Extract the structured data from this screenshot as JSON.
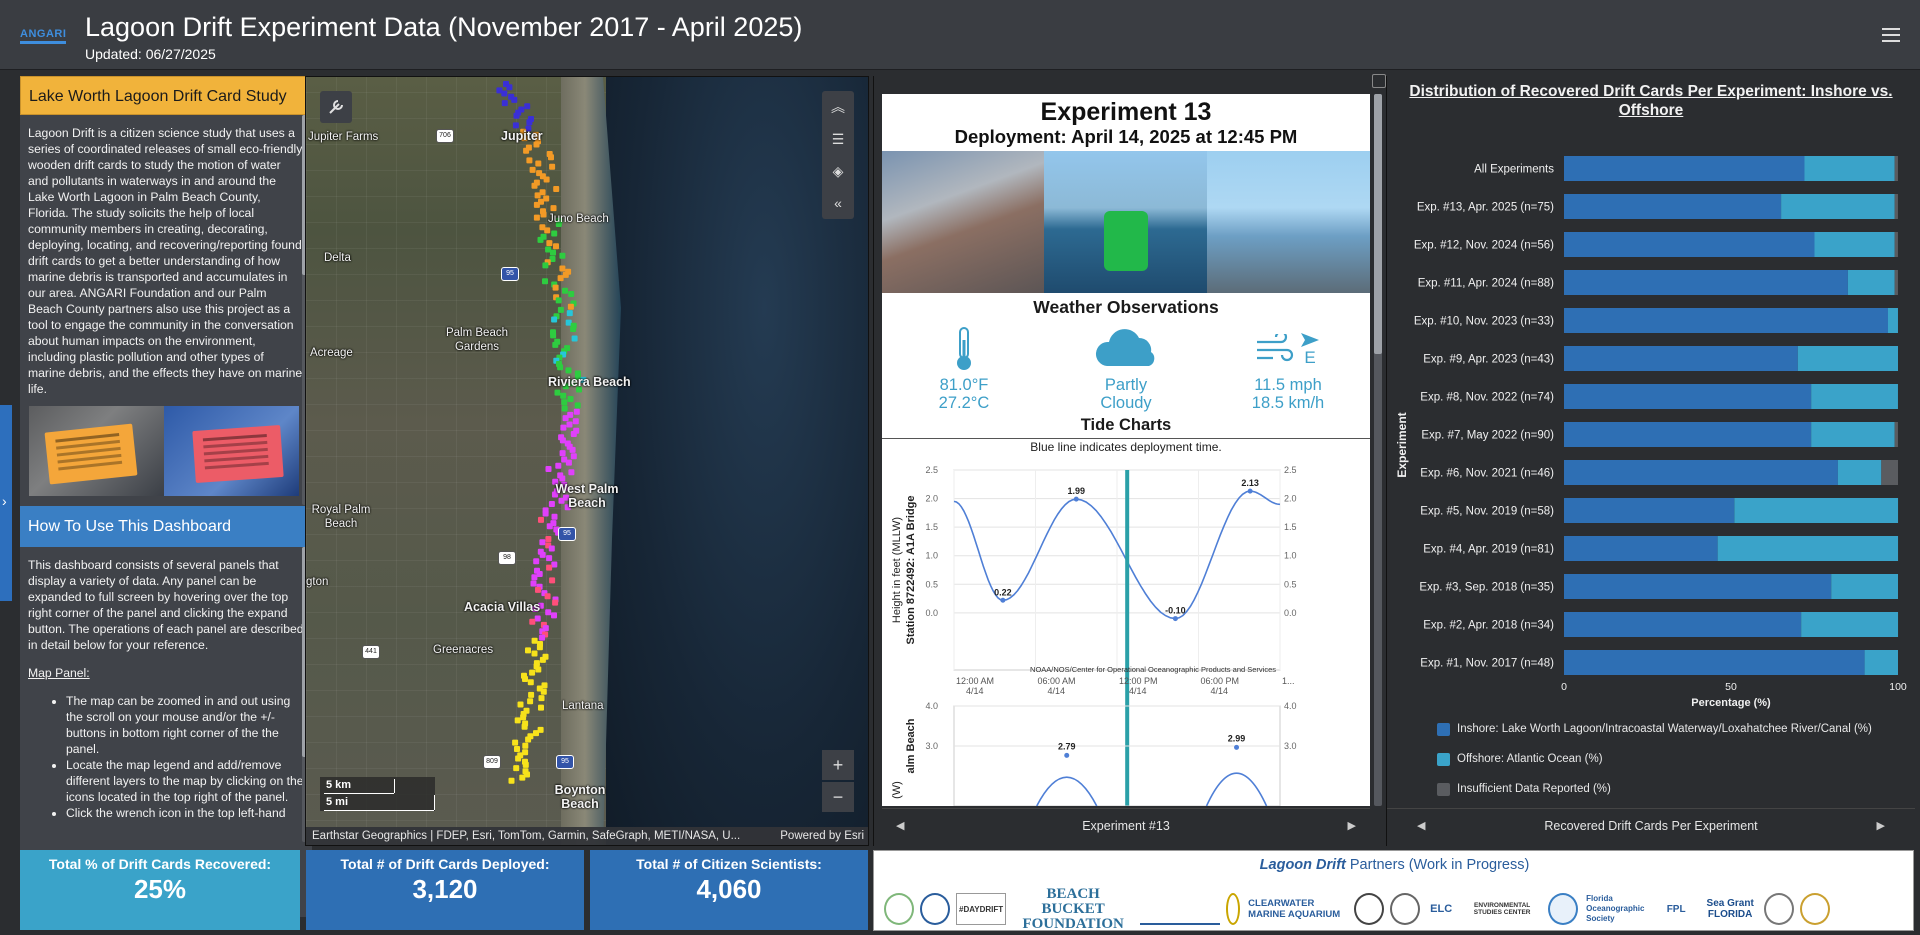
{
  "header": {
    "logo": "ANGARI",
    "title": "Lagoon Drift Experiment Data (November 2017 - April 2025)",
    "updated": "Updated: 06/27/2025"
  },
  "card_study": {
    "title": "Lake Worth Lagoon Drift Card Study",
    "body": "Lagoon Drift is a citizen science study that uses a series of coordinated releases of small eco-friendly wooden drift cards to study the motion of water and pollutants in waterways in and around the Lake Worth Lagoon in Palm Beach County, Florida. The study solicits the help of local community members in creating, decorating, deploying, locating, and recovering/reporting found drift cards to get a better understanding of how marine debris is transported and accumulates in our area. ANGARI Foundation and our Palm Beach County partners also use this project as a tool to engage the community in the conversation about human impacts on the environment, including plastic pollution and other types of marine debris, and the effects they have on marine life."
  },
  "howto": {
    "title": "How To Use This Dashboard",
    "intro": "This dashboard consists of several panels that display a variety of data. Any panel can be expanded to full screen by hovering over the top right corner of the panel and clicking the expand button. The operations of each panel are described in detail below for your reference.",
    "map_heading": "Map Panel:",
    "bullets": [
      "The map can be zoomed in and out using the scroll on your mouse and/or the +/- buttons in bottom right corner of the the panel.",
      "Locate the map legend and add/remove different layers to the map by clicking on the icons located in the top right of the panel.",
      "Click the wrench icon in the top left-hand"
    ]
  },
  "map": {
    "labels": {
      "jupiter_farms": "Jupiter Farms",
      "jupiter": "Jupiter",
      "juno_beach": "Juno Beach",
      "delta": "Delta",
      "palm_beach_gardens": "Palm Beach Gardens",
      "acreage": "Acreage",
      "riviera_beach": "Riviera Beach",
      "royal_palm_beach": "Royal Palm Beach",
      "west_palm_beach": "West Palm Beach",
      "wellington": "gton",
      "acacia_villas": "Acacia Villas",
      "greenacres": "Greenacres",
      "lantana": "Lantana",
      "boynton_beach": "Boynton Beach"
    },
    "shields": {
      "s706": "706",
      "s95a": "95",
      "s95b": "95",
      "s98": "98",
      "s441": "441",
      "s809": "809",
      "s95c": "95"
    },
    "scale_km": "5 km",
    "scale_mi": "5 mi",
    "attribution": "Earthstar Geographics | FDEP, Esri, TomTom, Garmin, SafeGraph, METI/NASA, U...",
    "powered": "Powered by Esri",
    "zoom_in": "+",
    "zoom_out": "−"
  },
  "experiment": {
    "title": "Experiment 13",
    "deployment": "Deployment: April 14, 2025 at 12:45 PM",
    "weather_title": "Weather Observations",
    "temp_f": "81.0°F",
    "temp_c": "27.2°C",
    "sky_1": "Partly",
    "sky_2": "Cloudy",
    "wind_dir": "E",
    "wind_mph": "11.5 mph",
    "wind_kmh": "18.5 km/h",
    "tide_title": "Tide Charts",
    "tide_note": "Blue line indicates deployment time.",
    "tide_ylabel_1": "Height in feet (MLLW)",
    "tide_ylabel_2": "Station 8722492: A1A Bridge",
    "tide_source": "NOAA/NOS/Center for Operational Oceanographic Products and Services",
    "tide2_ylabel_1": "(W)",
    "tide2_ylabel_2": "alm Beach",
    "nav_label": "Experiment #13",
    "tide_chart": {
      "type": "line",
      "x": [
        "12:00 AM 4/14",
        "06:00 AM 4/14",
        "12:00 PM 4/14",
        "06:00 PM 4/14",
        "1..."
      ],
      "annotations": [
        {
          "label": "0.22",
          "hour": 3.6,
          "value": 0.22
        },
        {
          "label": "1.99",
          "hour": 9.0,
          "value": 1.99
        },
        {
          "label": "-0.10",
          "hour": 16.3,
          "value": -0.1
        },
        {
          "label": "2.13",
          "hour": 21.8,
          "value": 2.13
        }
      ],
      "deployment_hour": 12.75,
      "ylim": [
        -0.3,
        2.5
      ],
      "yticks": [
        "2.5",
        "2.0",
        "1.5",
        "1.0",
        "0.5",
        "0.0"
      ],
      "xticks_top": [
        "12:00 AM",
        "06:00 AM",
        "12:00 PM",
        "06:00 PM",
        "1..."
      ],
      "xticks_bottom": [
        "4/14",
        "4/14",
        "4/14",
        "4/14",
        ""
      ]
    },
    "tide_chart_2": {
      "yticks": [
        "4.0",
        "3.0"
      ],
      "annotations": [
        {
          "label": "2.79",
          "hour": 8.3,
          "value": 2.79
        },
        {
          "label": "2.99",
          "hour": 20.8,
          "value": 2.99
        }
      ]
    }
  },
  "distribution": {
    "title": "Distribution of Recovered Drift Cards Per Experiment: Inshore vs. Offshore",
    "ylabel": "Experiment",
    "xlabel": "Percentage (%)",
    "xticks": [
      "0",
      "50",
      "100"
    ],
    "nav_label": "Recovered Drift Cards Per Experiment",
    "legend": [
      {
        "label": "Inshore: Lake Worth Lagoon/Intracoastal Waterway/Loxahatchee River/Canal (%)",
        "color": "#2e6fb4"
      },
      {
        "label": "Offshore: Atlantic Ocean (%)",
        "color": "#3aa3c9"
      },
      {
        "label": "Insufficient Data Reported (%)",
        "color": "#5a5c60"
      }
    ]
  },
  "chart_data": {
    "type": "bar",
    "orientation": "horizontal",
    "stacked": true,
    "title": "Distribution of Recovered Drift Cards Per Experiment: Inshore vs. Offshore",
    "xlabel": "Percentage (%)",
    "ylabel": "Experiment",
    "xlim": [
      0,
      100
    ],
    "categories": [
      "All Experiments",
      "Exp. #13, Apr. 2025 (n=75)",
      "Exp. #12, Nov. 2024 (n=56)",
      "Exp. #11, Apr. 2024 (n=88)",
      "Exp. #10, Nov. 2023 (n=33)",
      "Exp. #9, Apr. 2023 (n=43)",
      "Exp. #8, Nov. 2022 (n=74)",
      "Exp. #7, May 2022 (n=90)",
      "Exp. #6, Nov. 2021 (n=46)",
      "Exp. #5, Nov. 2019 (n=58)",
      "Exp. #4, Apr. 2019 (n=81)",
      "Exp. #3, Sep. 2018 (n=35)",
      "Exp. #2, Apr. 2018 (n=34)",
      "Exp. #1, Nov. 2017 (n=48)"
    ],
    "series": [
      {
        "name": "Inshore: Lake Worth Lagoon/Intracoastal Waterway/Loxahatchee River/Canal (%)",
        "color": "#2e6fb4",
        "values": [
          72,
          65,
          75,
          85,
          97,
          70,
          74,
          74,
          82,
          51,
          46,
          80,
          71,
          90
        ]
      },
      {
        "name": "Offshore: Atlantic Ocean (%)",
        "color": "#3aa3c9",
        "values": [
          27,
          34,
          24,
          14,
          3,
          30,
          26,
          25,
          13,
          49,
          54,
          20,
          29,
          10
        ]
      },
      {
        "name": "Insufficient Data Reported (%)",
        "color": "#5a5c60",
        "values": [
          1,
          1,
          1,
          1,
          0,
          0,
          0,
          1,
          5,
          0,
          0,
          0,
          0,
          0
        ]
      }
    ]
  },
  "stats": [
    {
      "label": "Total % of Drift Cards Recovered:",
      "value": "25%",
      "color": "#3aa3c9"
    },
    {
      "label": "Total # of Drift Cards Deployed:",
      "value": "3,120",
      "color": "#2e6fb4"
    },
    {
      "label": "Total # of Citizen Scientists:",
      "value": "4,060",
      "color": "#2e6fb4"
    }
  ],
  "partners": {
    "title_italic": "Lagoon Drift",
    "title_rest": " Partners (Work in Progress)",
    "logos": [
      "#DAYDRIFT",
      "BEACH BUCKET FOUNDATION",
      "CLEARWATER MARINE AQUARIUM",
      "ELC",
      "ENVIRONMENTAL STUDIES CENTER",
      "Florida Oceanographic Society",
      "FPL",
      "Sea Grant FLORIDA"
    ]
  },
  "icons": {
    "wrench": "wrench-icon",
    "collapse": "chevron-up-double-icon",
    "legend": "list-icon",
    "layers": "layers-icon",
    "back": "chevron-left-double-icon",
    "menu": "hamburger-menu-icon"
  }
}
